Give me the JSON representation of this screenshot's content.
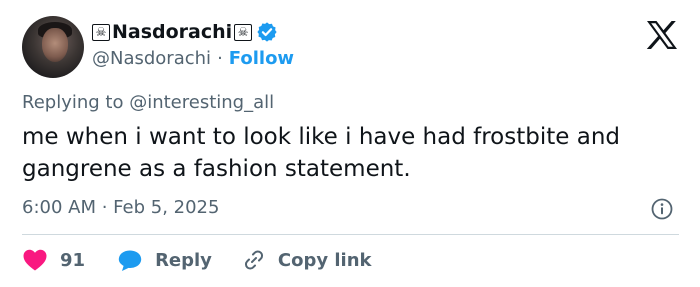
{
  "author": {
    "display_name": "Nasdorachi",
    "handle": "@Nasdorachi",
    "name_emoji": "☠",
    "verified": true,
    "verified_color": "#1d9bf0",
    "separator": "·",
    "follow_label": "Follow"
  },
  "tweet": {
    "replying_to": "Replying to @interesting_all",
    "text": "me when i want to look like i have had frostbite and gangrene as a fashion statement.",
    "timestamp": "6:00 AM · Feb 5, 2025"
  },
  "actions": {
    "like_count": "91",
    "reply_label": "Reply",
    "copy_label": "Copy link"
  },
  "colors": {
    "like": "#f91880",
    "reply": "#1d9bf0",
    "link": "#1d9bf0",
    "muted": "#536471"
  },
  "icons": [
    "skull-and-crossbones-icon",
    "verified-badge-icon",
    "x-logo-icon",
    "info-icon",
    "heart-icon",
    "reply-bubble-icon",
    "link-icon"
  ]
}
